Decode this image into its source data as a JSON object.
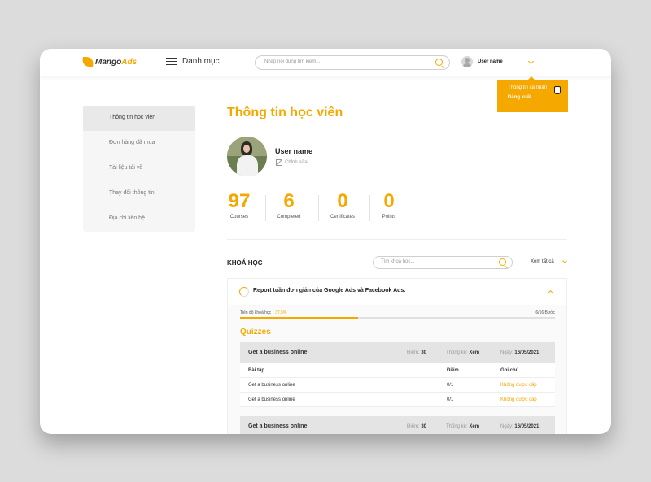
{
  "header": {
    "logo_mango": "Mango",
    "logo_ads": "Ads",
    "menu_label": "Danh mục",
    "search_placeholder": "Nhập nội dung tìm kiếm...",
    "user_name": "User name"
  },
  "dropdown": {
    "items": [
      "Thông tin cá nhân",
      "Đăng xuất"
    ]
  },
  "sidebar": {
    "items": [
      {
        "label": "Thông tin học viên"
      },
      {
        "label": "Đơn hàng đã mua"
      },
      {
        "label": "Tài liệu tải về"
      },
      {
        "label": "Thay đổi thông tin"
      },
      {
        "label": "Địa chỉ liên hệ"
      }
    ]
  },
  "profile": {
    "title": "Thông tin học viên",
    "name": "User name",
    "edit_label": "Chỉnh sửa"
  },
  "stats": [
    {
      "value": "97",
      "label": "Courses"
    },
    {
      "value": "6",
      "label": "Completed"
    },
    {
      "value": "0",
      "label": "Certificates"
    },
    {
      "value": "0",
      "label": "Points"
    }
  ],
  "courses": {
    "title": "KHOÁ HỌC",
    "search_placeholder": "Tìm khoá học...",
    "see_all": "Xem tất cả"
  },
  "course": {
    "name": "Report tuần đơn giản của Google Ads và Facebook Ads.",
    "progress_label": "Tiến độ khoá học",
    "progress_percent": "37.5%",
    "progress_value": 37.5,
    "progress_steps": "6/16 Bước",
    "quizzes_title": "Quizzes"
  },
  "quiz_groups": [
    {
      "name": "Get a business online",
      "score_label": "Điểm:",
      "score": "30",
      "stat_label": "Thống kê:",
      "stat": "Xem",
      "date_label": "Ngày:",
      "date": "16/05/2021",
      "columns": [
        "Bài tập",
        "Điểm",
        "Ghi chú"
      ],
      "rows": [
        {
          "name": "Get a business online",
          "score": "0/1",
          "note": "Không được cấp"
        },
        {
          "name": "Get a business online",
          "score": "0/1",
          "note": "Không được cấp"
        }
      ]
    },
    {
      "name": "Get a business online",
      "score_label": "Điểm:",
      "score": "30",
      "stat_label": "Thống kê:",
      "stat": "Xem",
      "date_label": "Ngày:",
      "date": "16/05/2021"
    }
  ],
  "colors": {
    "accent": "#f5a800",
    "sidebar_bg": "#f6f6f6",
    "sidebar_active": "#e9e9e9"
  }
}
